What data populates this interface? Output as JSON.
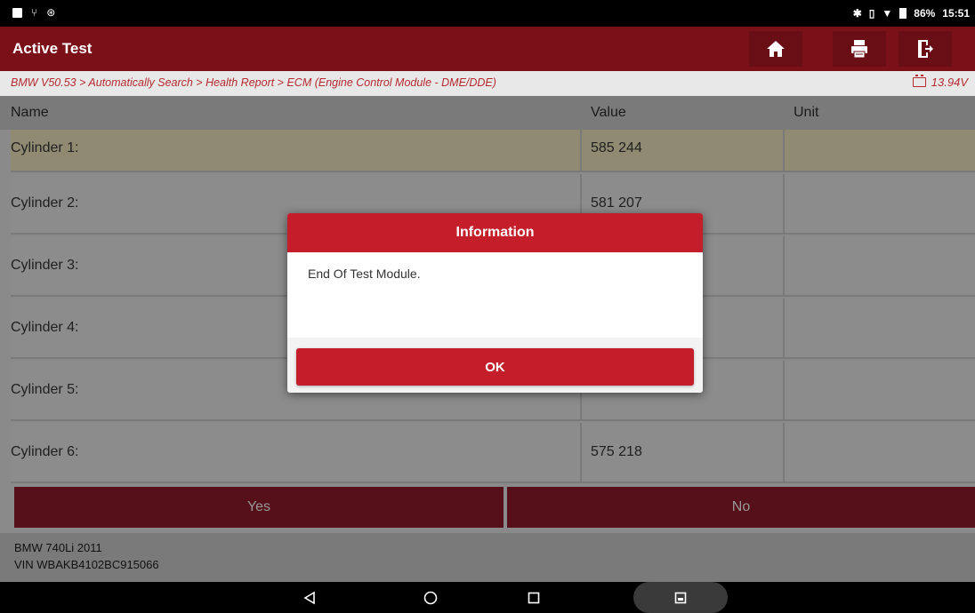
{
  "status_bar": {
    "battery_text": "86%",
    "time": "15:51"
  },
  "header": {
    "title": "Active Test",
    "icons": [
      "home-icon",
      "print-icon",
      "exit-icon"
    ]
  },
  "breadcrumb": {
    "path": "BMW V50.53 > Automatically Search > Health Report > ECM (Engine Control Module - DME/DDE)",
    "voltage": "13.94V"
  },
  "table": {
    "columns": [
      "Name",
      "Value",
      "Unit"
    ],
    "rows": [
      {
        "name": "Cylinder 1:",
        "value": "585 244",
        "unit": ""
      },
      {
        "name": "Cylinder 2:",
        "value": "581 207",
        "unit": ""
      },
      {
        "name": "Cylinder 3:",
        "value": "",
        "unit": ""
      },
      {
        "name": "Cylinder 4:",
        "value": "",
        "unit": ""
      },
      {
        "name": "Cylinder 5:",
        "value": "",
        "unit": ""
      },
      {
        "name": "Cylinder 6:",
        "value": "575 218",
        "unit": ""
      }
    ]
  },
  "actions": {
    "yes": "Yes",
    "no": "No"
  },
  "vehicle": {
    "model": "BMW 740Li 2011",
    "vin": "VIN WBAKB4102BC915066"
  },
  "dialog": {
    "title": "Information",
    "message": "End Of Test Module.",
    "ok": "OK"
  },
  "colors": {
    "header_bg": "#7a1018",
    "dialog_accent": "#c41e2a",
    "breadcrumb_text": "#b52a30"
  }
}
